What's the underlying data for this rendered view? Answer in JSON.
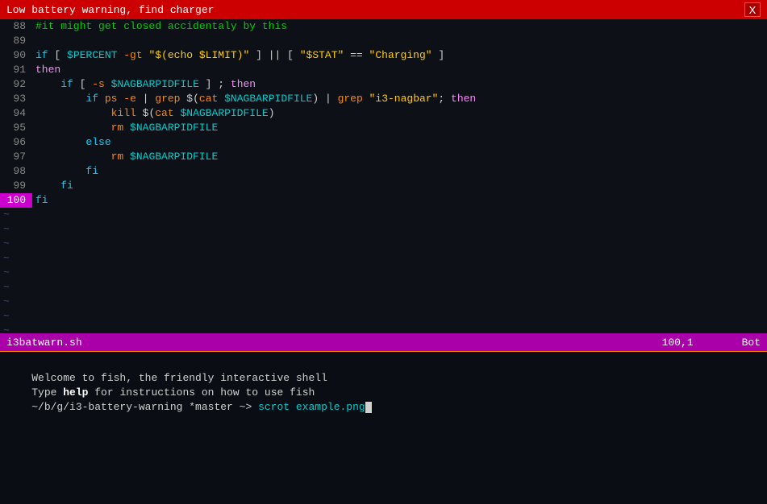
{
  "titlebar": {
    "title": "Low battery warning, find charger",
    "close_label": "X"
  },
  "editor": {
    "lines": [
      {
        "num": "88",
        "content": "#it might get closed accidentaly by this",
        "type": "comment"
      },
      {
        "num": "89",
        "content": "",
        "type": "empty"
      },
      {
        "num": "90",
        "content": "if [ $PERCENT -gt \"$(echo $LIMIT)\" ] || [ \"$STAT\" == \"Charging\" ]",
        "type": "code"
      },
      {
        "num": "91",
        "content": "then",
        "type": "then"
      },
      {
        "num": "92",
        "content": "    if [ -s $NAGBARPIDFILE ] ; then",
        "type": "code"
      },
      {
        "num": "93",
        "content": "        if ps -e | grep $(cat $NAGBARPIDFILE) | grep \"i3-nagbar\"; then",
        "type": "code"
      },
      {
        "num": "94",
        "content": "            kill $(cat $NAGBARPIDFILE)",
        "type": "code"
      },
      {
        "num": "95",
        "content": "            rm $NAGBARPIDFILE",
        "type": "code"
      },
      {
        "num": "96",
        "content": "        else",
        "type": "else"
      },
      {
        "num": "97",
        "content": "            rm $NAGBARPIDFILE",
        "type": "code"
      },
      {
        "num": "98",
        "content": "        fi",
        "type": "fi"
      },
      {
        "num": "99",
        "content": "    fi",
        "type": "fi"
      },
      {
        "num": "100",
        "content": "fi",
        "type": "fi",
        "current": true
      }
    ],
    "tildes": 10
  },
  "statusbar": {
    "filename": "i3batwarn.sh",
    "position": "100,1",
    "scroll": "Bot"
  },
  "terminal": {
    "line1": "Welcome to fish, the friendly interactive shell",
    "line2_pre": "Type ",
    "line2_help": "help",
    "line2_post": " for instructions on how to use fish",
    "line3_pre": "~/b/g/i3-battery-warning *master ~> ",
    "line3_cmd": "scrot example.png"
  }
}
